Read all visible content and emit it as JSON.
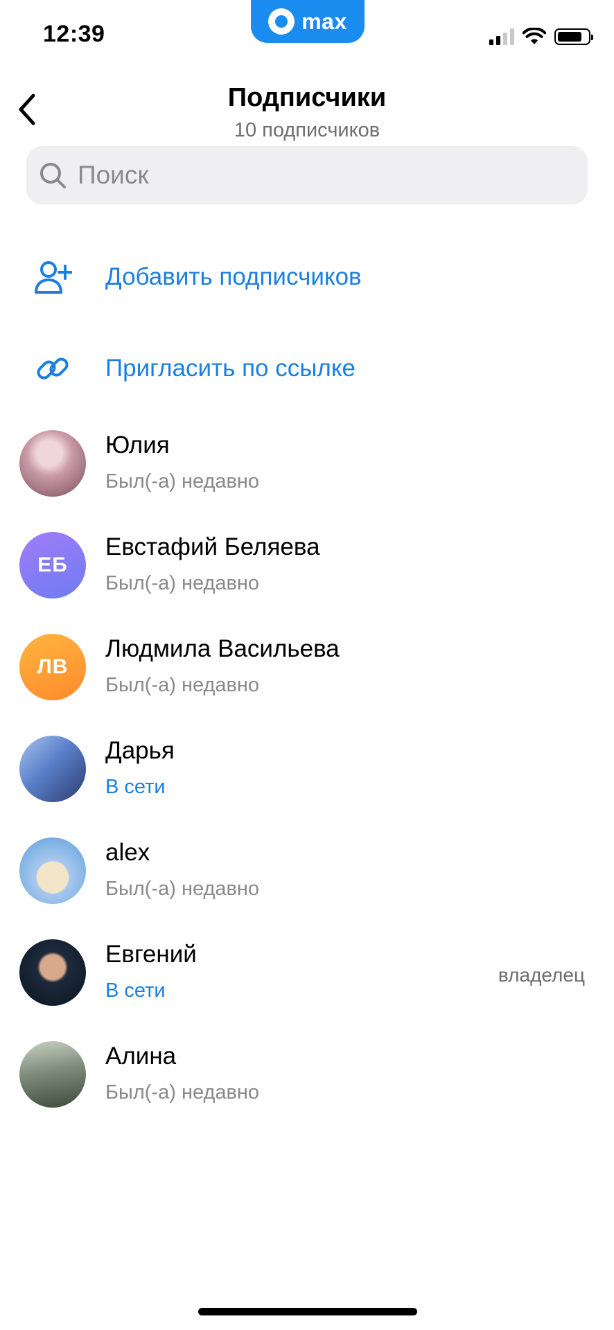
{
  "status_bar": {
    "time": "12:39",
    "app_name": "max"
  },
  "header": {
    "title": "Подписчики",
    "subtitle": "10 подписчиков"
  },
  "search": {
    "placeholder": "Поиск",
    "value": ""
  },
  "actions": [
    {
      "label": "Добавить подписчиков",
      "icon": "add-user-icon"
    },
    {
      "label": "Пригласить по ссылке",
      "icon": "link-icon"
    }
  ],
  "members": [
    {
      "name": "Юлия",
      "status": "Был(-а) недавно",
      "online": false,
      "avatar_type": "photo",
      "avatar_colors": [
        "#c99aa8",
        "#7a4b5a"
      ]
    },
    {
      "name": "Евстафий Беляева",
      "status": "Был(-а) недавно",
      "online": false,
      "avatar_type": "initials",
      "initials": "ЕБ",
      "avatar_colors": [
        "#9c7cf7",
        "#6f7cf2"
      ]
    },
    {
      "name": "Людмила Васильева",
      "status": "Был(-а) недавно",
      "online": false,
      "avatar_type": "initials",
      "initials": "ЛВ",
      "avatar_colors": [
        "#ffb13d",
        "#ff8a2b"
      ]
    },
    {
      "name": "Дарья",
      "status": "В сети",
      "online": true,
      "avatar_type": "photo",
      "avatar_colors": [
        "#5a7fc9",
        "#2d3c6e"
      ]
    },
    {
      "name": "alex",
      "status": "Был(-а) недавно",
      "online": false,
      "avatar_type": "photo",
      "avatar_colors": [
        "#a9c8ee",
        "#5aa0dc"
      ]
    },
    {
      "name": "Евгений",
      "status": "В сети",
      "online": true,
      "role": "владелец",
      "avatar_type": "photo",
      "avatar_colors": [
        "#1c2a3c",
        "#0d1520"
      ]
    },
    {
      "name": "Алина",
      "status": "Был(-а) недавно",
      "online": false,
      "avatar_type": "photo",
      "avatar_colors": [
        "#7f8c7a",
        "#3c4a3a"
      ]
    }
  ],
  "colors": {
    "accent": "#1a7fe0",
    "app_pill": "#1a8cf0",
    "secondary_text": "#8a8a8e"
  }
}
